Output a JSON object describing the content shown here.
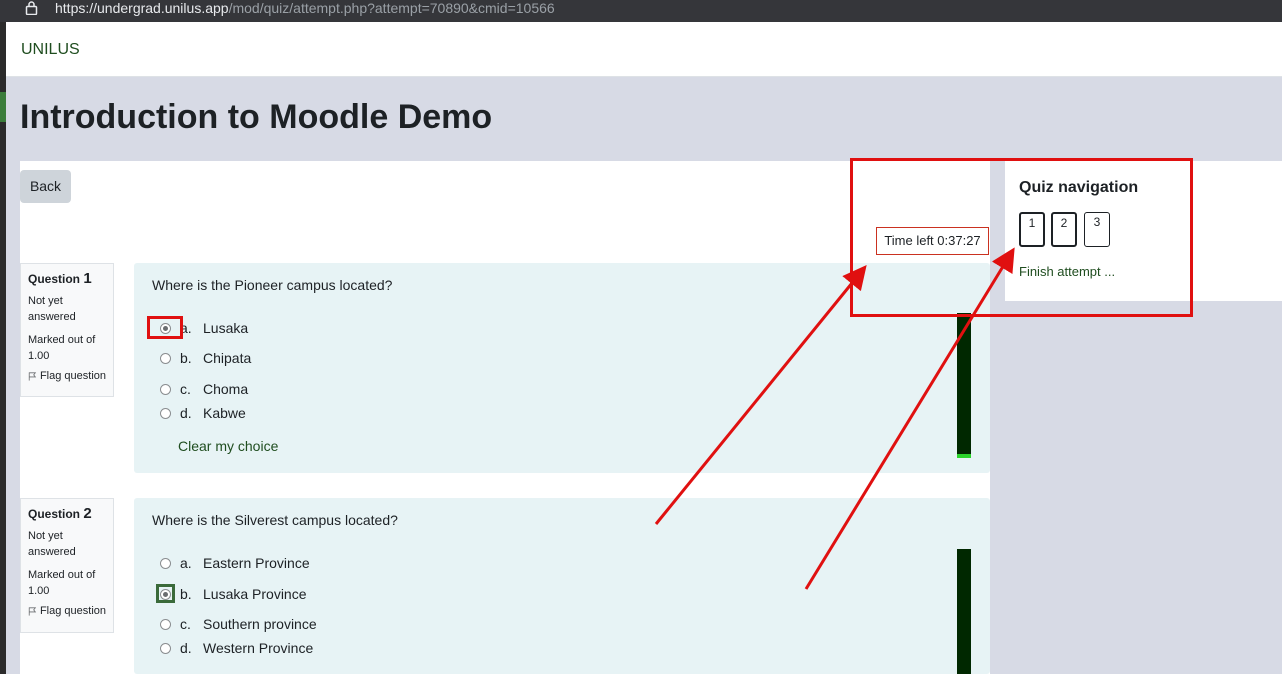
{
  "browser": {
    "url_host": "https://undergrad.unilus.app",
    "url_path": "/mod/quiz/attempt.php?attempt=70890&cmid=10566",
    "icons": {
      "lock": "lock-icon"
    }
  },
  "site": {
    "brand": "UNILUS"
  },
  "page": {
    "title": "Introduction to Moodle Demo",
    "back_label": "Back",
    "timer": "Time left 0:37:27"
  },
  "questions": [
    {
      "label": "Question",
      "number": "1",
      "state": "Not yet answered",
      "grade": "Marked out of 1.00",
      "flag_label": "Flag question",
      "text": "Where is the Pioneer campus located?",
      "answers": [
        {
          "letter": "a.",
          "text": "Lusaka",
          "checked": true
        },
        {
          "letter": "b.",
          "text": "Chipata",
          "checked": false
        },
        {
          "letter": "c.",
          "text": "Choma",
          "checked": false
        },
        {
          "letter": "d.",
          "text": "Kabwe",
          "checked": false
        }
      ],
      "clear_label": "Clear my choice"
    },
    {
      "label": "Question",
      "number": "2",
      "state": "Not yet answered",
      "grade": "Marked out of 1.00",
      "flag_label": "Flag question",
      "text": "Where is the Silverest campus located?",
      "answers": [
        {
          "letter": "a.",
          "text": "Eastern Province",
          "checked": false
        },
        {
          "letter": "b.",
          "text": "Lusaka Province",
          "checked": true
        },
        {
          "letter": "c.",
          "text": "Southern province",
          "checked": false
        },
        {
          "letter": "d.",
          "text": "Western Province",
          "checked": false
        }
      ]
    }
  ],
  "quiz_nav": {
    "title": "Quiz navigation",
    "buttons": [
      "1",
      "2",
      "3"
    ],
    "finish_label": "Finish attempt ..."
  },
  "colors": {
    "annotation_red": "#e01010",
    "link_green": "#1f4d1f",
    "question_bg": "#e7f3f5"
  }
}
